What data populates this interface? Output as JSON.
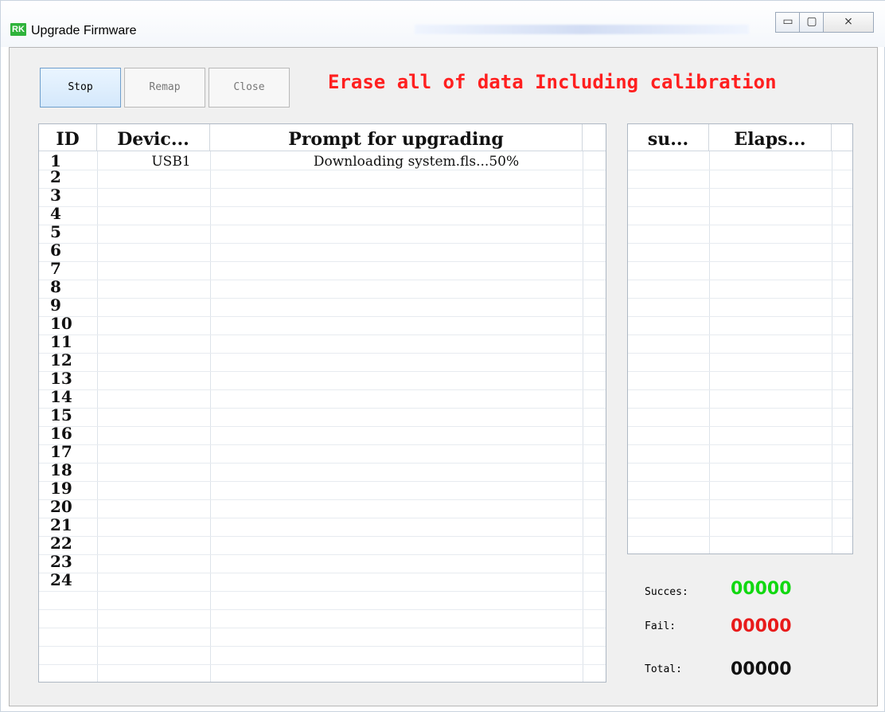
{
  "window": {
    "title": "Upgrade Firmware",
    "app_icon_text": "RK"
  },
  "toolbar": {
    "stop_label": "Stop",
    "remap_label": "Remap",
    "close_label": "Close"
  },
  "warning_text": "Erase all of data Including calibration",
  "left_table": {
    "columns": [
      "ID",
      "Devic...",
      "Prompt for upgrading"
    ],
    "rows": [
      {
        "id": "1",
        "device": "USB1",
        "prompt": "Downloading system.fls...50%"
      },
      {
        "id": "2",
        "device": "",
        "prompt": ""
      },
      {
        "id": "3",
        "device": "",
        "prompt": ""
      },
      {
        "id": "4",
        "device": "",
        "prompt": ""
      },
      {
        "id": "5",
        "device": "",
        "prompt": ""
      },
      {
        "id": "6",
        "device": "",
        "prompt": ""
      },
      {
        "id": "7",
        "device": "",
        "prompt": ""
      },
      {
        "id": "8",
        "device": "",
        "prompt": ""
      },
      {
        "id": "9",
        "device": "",
        "prompt": ""
      },
      {
        "id": "10",
        "device": "",
        "prompt": ""
      },
      {
        "id": "11",
        "device": "",
        "prompt": ""
      },
      {
        "id": "12",
        "device": "",
        "prompt": ""
      },
      {
        "id": "13",
        "device": "",
        "prompt": ""
      },
      {
        "id": "14",
        "device": "",
        "prompt": ""
      },
      {
        "id": "15",
        "device": "",
        "prompt": ""
      },
      {
        "id": "16",
        "device": "",
        "prompt": ""
      },
      {
        "id": "17",
        "device": "",
        "prompt": ""
      },
      {
        "id": "18",
        "device": "",
        "prompt": ""
      },
      {
        "id": "19",
        "device": "",
        "prompt": ""
      },
      {
        "id": "20",
        "device": "",
        "prompt": ""
      },
      {
        "id": "21",
        "device": "",
        "prompt": ""
      },
      {
        "id": "22",
        "device": "",
        "prompt": ""
      },
      {
        "id": "23",
        "device": "",
        "prompt": ""
      },
      {
        "id": "24",
        "device": "",
        "prompt": ""
      }
    ]
  },
  "right_table": {
    "columns": [
      "su...",
      "Elaps..."
    ]
  },
  "stats": {
    "success_label": "Succes:",
    "success_value": "00000",
    "fail_label": "Fail:",
    "fail_value": "00000",
    "total_label": "Total:",
    "total_value": "00000"
  },
  "colors": {
    "warning": "#ff1f1f",
    "success": "#11d811",
    "fail": "#e81b1b"
  }
}
